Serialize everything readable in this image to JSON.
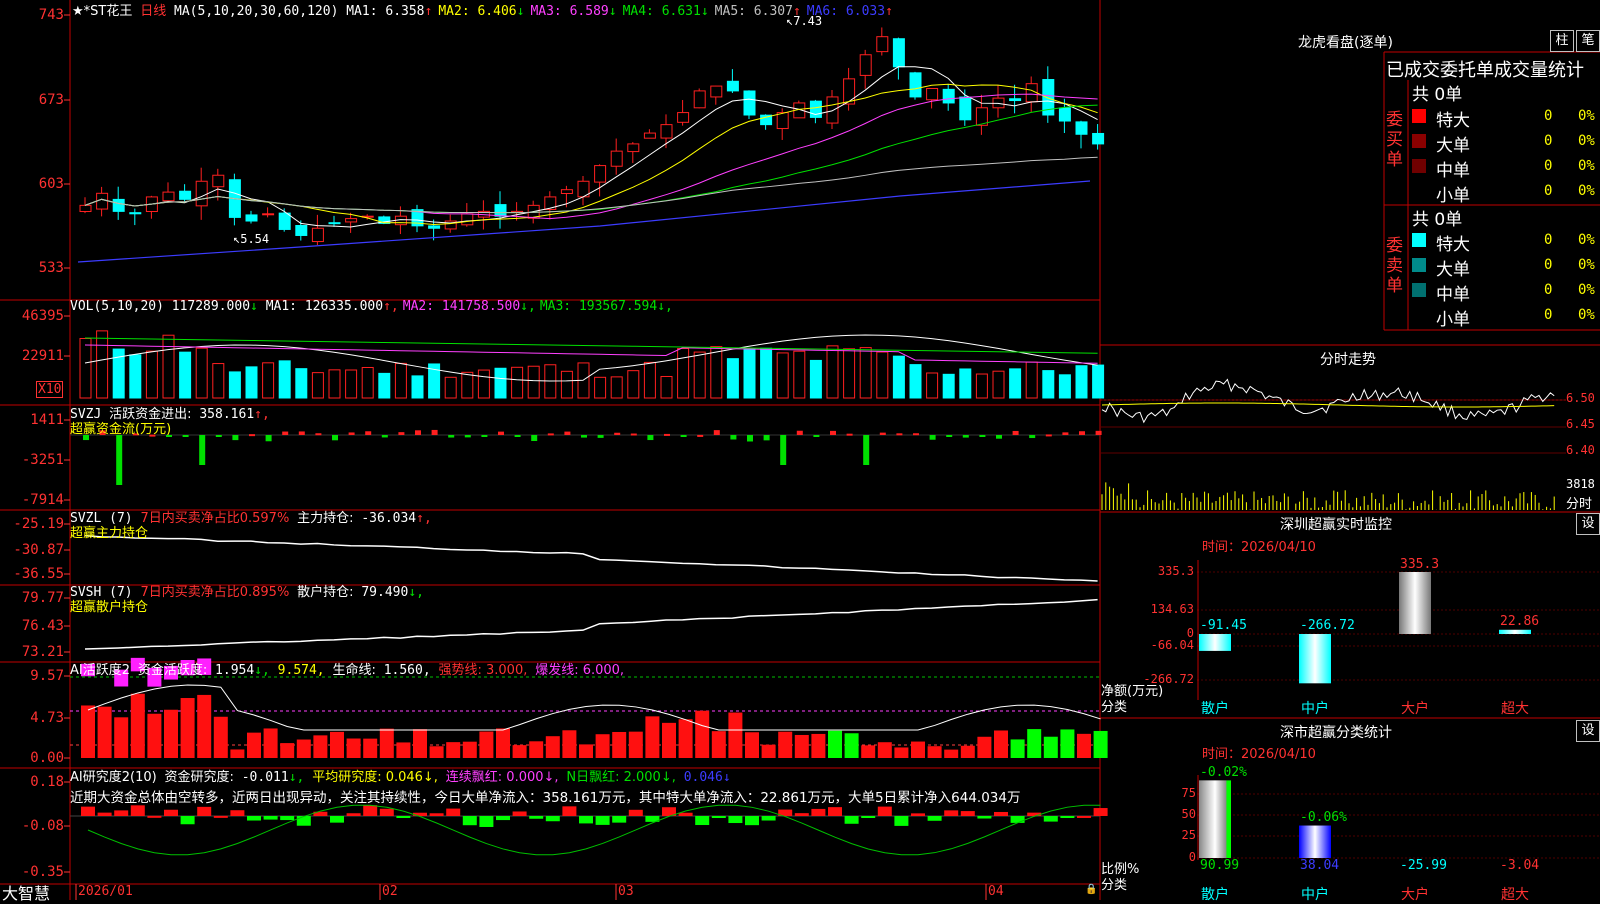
{
  "main": {
    "title": "★*ST花王",
    "period": "日线",
    "ma_label": "MA(5,10,20,30,60,120)",
    "ma_values": [
      {
        "label": "MA1:",
        "value": "6.358",
        "arrow": "↑",
        "color": "#ffffff"
      },
      {
        "label": "MA2:",
        "value": "6.406",
        "arrow": "↓",
        "color": "#ffff00"
      },
      {
        "label": "MA3:",
        "value": "6.589",
        "arrow": "↓",
        "color": "#ff40ff"
      },
      {
        "label": "MA4:",
        "value": "6.631",
        "arrow": "↓",
        "color": "#00e000"
      },
      {
        "label": "MA5:",
        "value": "6.307",
        "arrow": "↑",
        "color": "#c0c0c0"
      },
      {
        "label": "MA6:",
        "value": "6.033",
        "arrow": "↑",
        "color": "#3c3cff"
      }
    ],
    "y_ticks": [
      "743",
      "673",
      "603",
      "533"
    ],
    "high_label": "7.43",
    "low_label": "5.54"
  },
  "vol": {
    "label": "VOL(5,10,20)",
    "value": "117289.000",
    "value_arrow": "↓",
    "ma": [
      {
        "label": "MA1:",
        "value": "126335.000",
        "arrow": "↑",
        "color": "#ffffff"
      },
      {
        "label": "MA2:",
        "value": "141758.500",
        "arrow": "↓",
        "color": "#ff40ff"
      },
      {
        "label": "MA3:",
        "value": "193567.594",
        "arrow": "↓",
        "color": "#00e000"
      }
    ],
    "y_ticks": [
      "46395",
      "22911"
    ],
    "unit": "X10"
  },
  "svzj": {
    "label": "SVZJ",
    "item": "活跃资金进出:",
    "value": "358.161",
    "arrow": "↑,",
    "sublabel": "超赢资金流(万元)",
    "y_ticks": [
      "1411",
      "-3251",
      "-7914"
    ]
  },
  "svzl": {
    "label": "SVZL (7)",
    "item1": "7日内买卖净占比0.597%",
    "item2": "主力持仓:",
    "value": "-36.034",
    "arrow": "↑,",
    "sublabel": "超赢主力持仓",
    "y_ticks": [
      "-25.19",
      "-30.87",
      "-36.55"
    ]
  },
  "svsh": {
    "label": "SVSH (7)",
    "item1": "7日内买卖净占比0.895%",
    "item2": "散户持仓:",
    "value": "79.490",
    "arrow": "↓,",
    "sublabel": "超赢散户持仓",
    "y_ticks": [
      "79.77",
      "76.43",
      "73.21"
    ]
  },
  "ai1": {
    "label": "AI活跃度2",
    "item": "资金活跃度:",
    "value": "1.954",
    "arrow": "↓,",
    "v2": "9.574,",
    "life_label": "生命线:",
    "life_value": "1.560,",
    "strong": "强势线: 3.000,",
    "burst": "爆发线: 6.000,",
    "y_ticks": [
      "9.57",
      "4.73",
      "0.00"
    ]
  },
  "ai2": {
    "label": "AI研究度2(10)",
    "item": "资金研究度:",
    "value": "-0.011",
    "arrow": "↓,",
    "avg": "平均研究度: 0.046↓,",
    "cont": "连续飘红: 0.000↓,",
    "nday": "N日飘红: 2.000↓,",
    "last": "0.046↓",
    "comment": "近期大资金总体由空转多，近两日出现异动，关注其持续性，今日大单净流入：358.161万元，其中特大单净流入：22.861万元，大单5日累计净入644.034万",
    "y_ticks": [
      "0.18",
      "-0.08",
      "-0.35"
    ]
  },
  "x_axis": {
    "labels": [
      "2026/01",
      "02",
      "03",
      "04"
    ]
  },
  "footer": {
    "brand": "大智慧"
  },
  "lhb": {
    "title": "龙虎看盘(逐单)",
    "btn1": "柱",
    "btn2": "笔",
    "heading": "已成交委托单成交量统计",
    "buy_label": "委买单",
    "sell_label": "委卖单",
    "buy_total": "共 0单",
    "sell_total": "共 0单",
    "rows_buy": [
      {
        "name": "特大",
        "count": "0",
        "pct": "0%",
        "color": "#ff0000"
      },
      {
        "name": "大单",
        "count": "0",
        "pct": "0%",
        "color": "#8b0000"
      },
      {
        "name": "中单",
        "count": "0",
        "pct": "0%",
        "color": "#700000"
      },
      {
        "name": "小单",
        "count": "0",
        "pct": "0%",
        "color": "#000000"
      }
    ],
    "rows_sell": [
      {
        "name": "特大",
        "count": "0",
        "pct": "0%",
        "color": "#00ffff"
      },
      {
        "name": "大单",
        "count": "0",
        "pct": "0%",
        "color": "#008b8b"
      },
      {
        "name": "中单",
        "count": "0",
        "pct": "0%",
        "color": "#007070"
      },
      {
        "name": "小单",
        "count": "0",
        "pct": "0%",
        "color": "#000000"
      }
    ]
  },
  "fenshi": {
    "title": "分时走势",
    "right_ticks": [
      "6.50",
      "6.45",
      "6.40"
    ],
    "vol_label": "3818",
    "unit": "分时"
  },
  "sz_monitor": {
    "title": "深圳超赢实时监控",
    "btn": "设",
    "time": "时间：2026/04/10",
    "y_ticks": [
      "335.3",
      "134.63",
      "0",
      "-66.04",
      "-266.72"
    ],
    "y_label1": "净额(万元)",
    "y_label2": "分类",
    "categories": [
      "散户",
      "中户",
      "大户",
      "超大"
    ],
    "values": [
      -91.45,
      -266.72,
      335.3,
      22.86
    ],
    "value_labels": [
      "-91.45",
      "-266.72",
      "335.3",
      "22.86"
    ]
  },
  "sz_class": {
    "title": "深市超赢分类统计",
    "btn": "设",
    "time": "时间：2026/04/10",
    "y_ticks": [
      "75",
      "50",
      "25",
      "0"
    ],
    "y_label1": "比例%",
    "y_label2": "分类",
    "categories": [
      "散户",
      "中户",
      "大户",
      "超大"
    ],
    "top_labels": [
      "-0.02%",
      "-0.06%"
    ],
    "bottom_values": [
      "90.99",
      "38.04",
      "-25.99",
      "-3.04"
    ],
    "ratios": [
      90.99,
      38.04
    ]
  }
}
